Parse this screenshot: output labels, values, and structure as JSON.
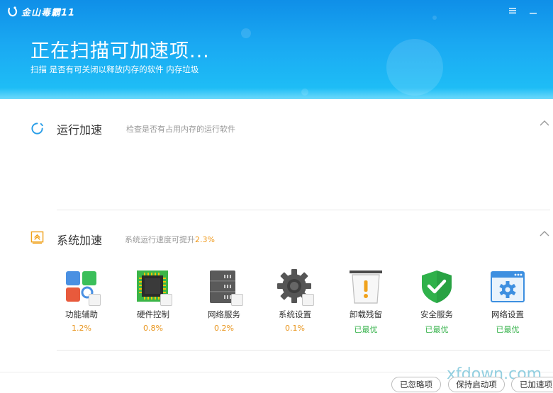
{
  "app": {
    "title": "金山毒霸11",
    "menu_icon": "hamburger-menu-icon",
    "minimize_icon": "minimize-icon"
  },
  "header": {
    "title": "正在扫描可加速项...",
    "subtitle": "扫描 是否有可关闭以释放内存的软件 内存垃圾"
  },
  "sections": {
    "running": {
      "title": "运行加速",
      "desc": "检查是否有占用内存的运行软件",
      "icon": "spinner-icon"
    },
    "system": {
      "title": "系统加速",
      "desc_prefix": "系统运行速度可提升",
      "desc_value": "2.3%",
      "icon": "speed-up-icon"
    }
  },
  "items": [
    {
      "label": "功能辅助",
      "value": "1.2%",
      "status": "orange",
      "icon": "function-assist-icon"
    },
    {
      "label": "硬件控制",
      "value": "0.8%",
      "status": "orange",
      "icon": "chip-icon"
    },
    {
      "label": "网络服务",
      "value": "0.2%",
      "status": "orange",
      "icon": "server-icon"
    },
    {
      "label": "系统设置",
      "value": "0.1%",
      "status": "orange",
      "icon": "gear-icon"
    },
    {
      "label": "卸载残留",
      "value": "已最优",
      "status": "green",
      "icon": "trash-warning-icon"
    },
    {
      "label": "安全服务",
      "value": "已最优",
      "status": "green",
      "icon": "shield-check-icon"
    },
    {
      "label": "网络设置",
      "value": "已最优",
      "status": "green",
      "icon": "network-settings-icon"
    }
  ],
  "footer": {
    "ignored": "已忽略项",
    "keep_startup": "保持启动项",
    "accelerated": "已加速项"
  },
  "watermark": "xfdown.com",
  "colors": {
    "header_top": "#0f8fe8",
    "header_bottom": "#1fc2f7",
    "orange": "#e8951d",
    "green": "#35b24a"
  }
}
